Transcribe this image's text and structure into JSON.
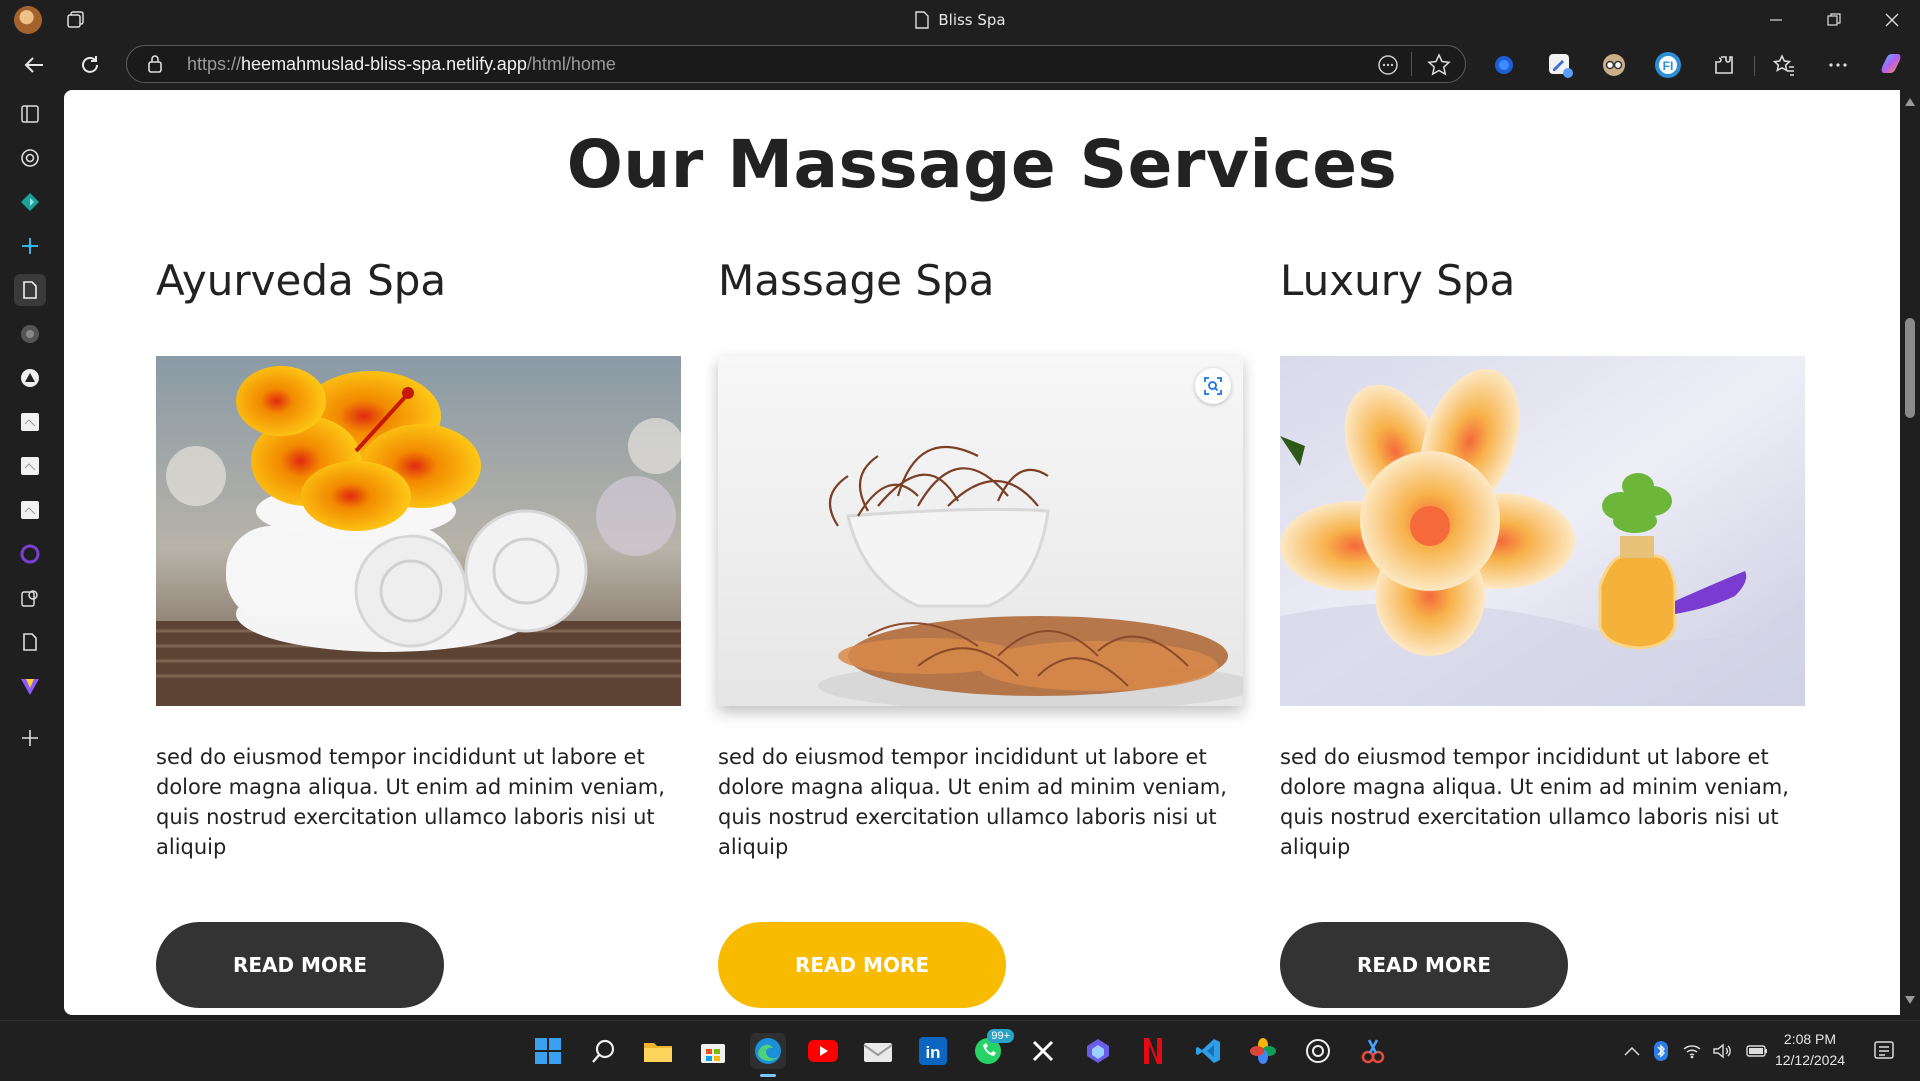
{
  "browser": {
    "tab_title": "Bliss Spa",
    "url_prefix": "https://",
    "url_host": "heemahmuslad-bliss-spa.netlify.app",
    "url_path": "/html/home"
  },
  "page": {
    "heading": "Our Massage Services",
    "cards": [
      {
        "title": "Ayurveda Spa",
        "text": "sed do eiusmod tempor incididunt ut labore et dolore magna aliqua. Ut enim ad minim veniam, quis nostrud exercitation ullamco laboris nisi ut aliquip",
        "button": "READ MORE"
      },
      {
        "title": "Massage Spa",
        "text": "sed do eiusmod tempor incididunt ut labore et dolore magna aliqua. Ut enim ad minim veniam, quis nostrud exercitation ullamco laboris nisi ut aliquip",
        "button": "READ MORE"
      },
      {
        "title": "Luxury Spa",
        "text": "sed do eiusmod tempor incididunt ut labore et dolore magna aliqua. Ut enim ad minim veniam, quis nostrud exercitation ullamco laboris nisi ut aliquip",
        "button": "READ MORE"
      }
    ]
  },
  "taskbar": {
    "whatsapp_badge": "99+",
    "time": "2:08 PM",
    "date": "12/12/2024"
  },
  "colors": {
    "button_dark": "#333333",
    "button_accent": "#f9bb00"
  }
}
